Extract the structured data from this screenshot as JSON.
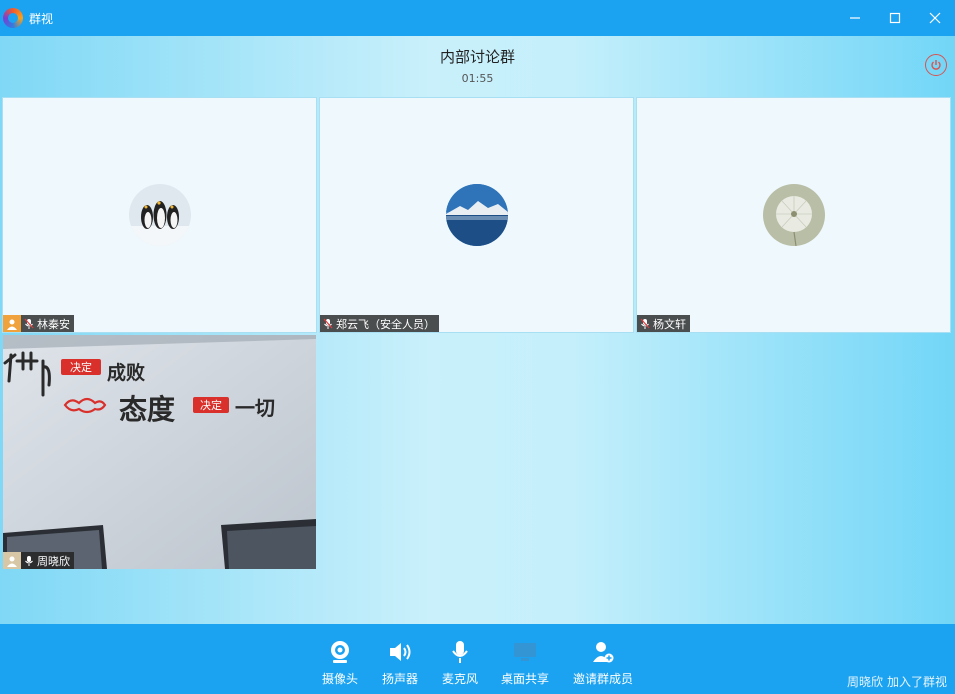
{
  "window": {
    "title": "群视",
    "app_logo": "firefox-like-logo-icon"
  },
  "header": {
    "group_name": "内部讨论群",
    "timer": "01:55"
  },
  "participants": [
    {
      "name": "林秦安",
      "avatar": "penguins"
    },
    {
      "name": "郑云飞（安全人员）",
      "avatar": "mountain-lake"
    },
    {
      "name": "杨文轩",
      "avatar": "dandelion"
    }
  ],
  "self_video": {
    "name": "周晓欣",
    "wall_text": {
      "line1_a": "节",
      "line1_tag": "决定",
      "line1_b": "成败",
      "line2_a": "态度",
      "line2_tag": "决定",
      "line2_b": "一切"
    }
  },
  "toolbar": {
    "camera": "摄像头",
    "speaker": "扬声器",
    "microphone": "麦克风",
    "screen_share": "桌面共享",
    "invite": "邀请群成员"
  },
  "status": {
    "user": "周晓欣",
    "message": "加入了群视"
  },
  "colors": {
    "titlebar": "#1ba3f2",
    "toolbar": "#1ba3f2",
    "power": "#d9534f",
    "tag_red": "#d9302c"
  }
}
